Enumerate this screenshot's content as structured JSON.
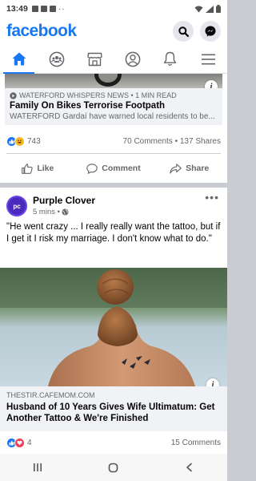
{
  "status_bar": {
    "time": "13:49",
    "dots": "··"
  },
  "header": {
    "logo": "facebook",
    "icons": [
      "search-icon",
      "messenger-icon"
    ]
  },
  "nav_tabs": [
    {
      "name": "home",
      "icon": "home-icon",
      "active": true
    },
    {
      "name": "groups",
      "icon": "groups-icon",
      "active": false
    },
    {
      "name": "marketplace",
      "icon": "store-icon",
      "active": false
    },
    {
      "name": "profile",
      "icon": "profile-icon",
      "active": false
    },
    {
      "name": "notifications",
      "icon": "bell-icon",
      "active": false
    },
    {
      "name": "menu",
      "icon": "hamburger-icon",
      "active": false
    }
  ],
  "post1": {
    "link_source": "WATERFORD WHISPERS NEWS • 1 MIN READ",
    "link_title": "Family On Bikes Terrorise Footpath",
    "link_desc": "WATERFORD Gardaí have warned local residents to be...",
    "reaction_count": "743",
    "comments_shares": "70 Comments • 137 Shares",
    "actions": {
      "like": "Like",
      "comment": "Comment",
      "share": "Share"
    }
  },
  "post2": {
    "page_name": "Purple Clover",
    "avatar_text": "pc",
    "time": "5 mins •",
    "text": "\"He went crazy ... I really really want the tattoo, but if I get it I risk my marriage. I don't know what to do.\"",
    "link_source": "THESTIR.CAFEMOM.COM",
    "link_title": "Husband of 10 Years Gives Wife Ultimatum: Get Another Tattoo & We're Finished",
    "reaction_count": "4",
    "comments": "15 Comments"
  },
  "colors": {
    "brand": "#1877f2",
    "like": "#1877f2",
    "love": "#f33e58",
    "haha": "#f7b928",
    "secondary_text": "#65676b"
  }
}
